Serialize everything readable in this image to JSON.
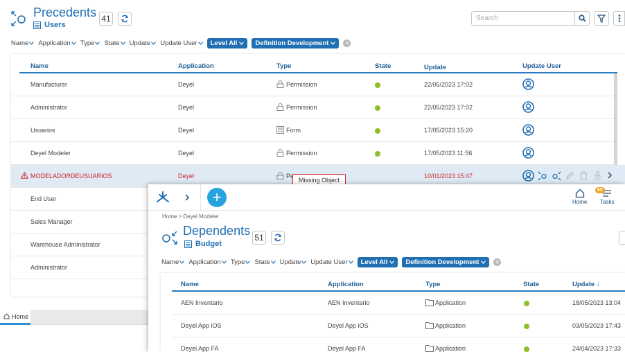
{
  "back": {
    "title": "Precedents",
    "subtitle": "Users",
    "count": "41",
    "search_placeholder": "Search",
    "filters": [
      "Name",
      "Application",
      "Type",
      "State",
      "Update",
      "Update User"
    ],
    "chips": [
      "Level All",
      "Definition Development"
    ],
    "columns": [
      "Name",
      "Application",
      "Type",
      "State",
      "Update",
      "Update User"
    ],
    "sort_arrow": "↓",
    "rows": [
      {
        "name": "Manufacturer",
        "app": "Deyel",
        "type": "Permission",
        "type_icon": "lock-icon",
        "update": "22/05/2023 17:02",
        "user": true
      },
      {
        "name": "Administrator",
        "app": "Deyel",
        "type": "Permission",
        "type_icon": "lock-icon",
        "update": "22/05/2023 17:02",
        "user": true
      },
      {
        "name": "Usuarios",
        "app": "Deyel",
        "type": "Form",
        "type_icon": "form-icon",
        "update": "17/05/2023 15:20",
        "user": true
      },
      {
        "name": "Deyel Modeler",
        "app": "Deyel",
        "type": "Permission",
        "type_icon": "lock-icon",
        "update": "17/05/2023 11:56",
        "user": true
      },
      {
        "name": "MODELADORDEUSUARIOS",
        "app": "Deyel",
        "type": "Pe",
        "type_icon": "lock-icon",
        "update": "10/01/2023 15:47",
        "user": true,
        "error": true
      },
      {
        "name": "End User"
      },
      {
        "name": "Sales Manager"
      },
      {
        "name": "Warehouse Administrator"
      },
      {
        "name": "Administrator"
      }
    ],
    "tooltip": "Missing Object",
    "home_tab": "Home"
  },
  "front": {
    "nav_home": "Home",
    "nav_tasks": "Tasks",
    "tasks_badge": "60",
    "breadcrumb_home": "Home",
    "breadcrumb_sep": ">",
    "breadcrumb_current": "Deyel Modeler",
    "title": "Dependents",
    "subtitle": "Budget",
    "count": "51",
    "filters": [
      "Name",
      "Application",
      "Type",
      "State",
      "Update",
      "Update User"
    ],
    "chips": [
      "Level All",
      "Definition Development"
    ],
    "columns": [
      "Name",
      "Application",
      "Type",
      "State",
      "Update"
    ],
    "sort_arrow": "↓",
    "rows": [
      {
        "name": "AEN Inventario",
        "app": "AEN Inventario",
        "type": "Application",
        "update": "18/05/2023 13:04"
      },
      {
        "name": "Deyel App iOS",
        "app": "Deyel App iOS",
        "type": "Application",
        "update": "03/05/2023 17:43"
      },
      {
        "name": "Deyel App FA",
        "app": "Deyel App FA",
        "type": "Application",
        "update": "24/04/2023 17:33"
      }
    ]
  },
  "colors": {
    "accent": "#1f6fb2",
    "error": "#d0222a",
    "state_ok": "#8fbf2a",
    "fab": "#27a3e0"
  }
}
